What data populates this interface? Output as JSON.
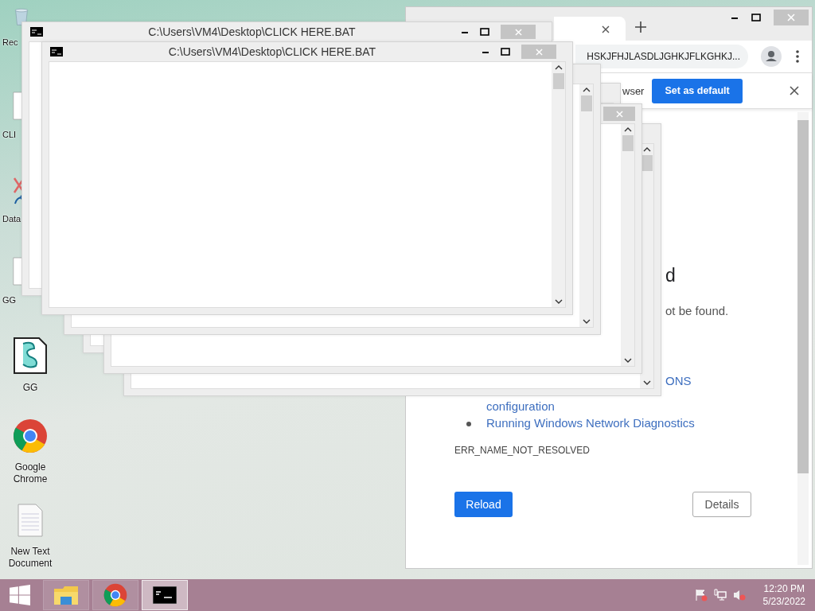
{
  "desktop_icons": [
    {
      "label": "Rec",
      "kind": "recycle"
    },
    {
      "label": "CLI",
      "kind": "file"
    },
    {
      "label": "Data",
      "kind": "shortcut"
    },
    {
      "label": "GG",
      "kind": "file"
    },
    {
      "label": "GG",
      "kind": "script"
    },
    {
      "label": "Google Chrome",
      "kind": "chrome"
    },
    {
      "label": "New Text Document",
      "kind": "text"
    }
  ],
  "browser": {
    "address": "HSKJFHJLASDLJGHKJFLKGHKJ...",
    "infobar": {
      "message": "wser",
      "button": "Set as default"
    },
    "error_page": {
      "heading": "d",
      "message": "ot be found.",
      "suggestion_fragment": "ONS",
      "suggestion_continued": "configuration",
      "suggestion": "Running Windows Network Diagnostics",
      "error_code": "ERR_NAME_NOT_RESOLVED",
      "buttons": [
        {
          "label": "Reload",
          "kind": "primary"
        },
        {
          "label": "Details",
          "kind": "secondary"
        }
      ]
    }
  },
  "consoles": [
    {
      "kind": "console"
    },
    {
      "kind": "console"
    },
    {
      "kind": "console"
    },
    {
      "kind": "console"
    },
    {
      "kind": "console",
      "title": "C:\\Users\\VM4\\Desktop\\CLICK HERE.BAT"
    },
    {
      "kind": "console",
      "title": "C:\\Users\\VM4\\Desktop\\CLICK HERE.BAT"
    }
  ],
  "taskbar": {
    "apps": [
      {
        "kind": "explorer",
        "selected": false
      },
      {
        "kind": "chrome",
        "selected": false
      },
      {
        "kind": "console",
        "selected": true
      }
    ],
    "time": "12:20 PM",
    "date": "5/23/2022"
  }
}
